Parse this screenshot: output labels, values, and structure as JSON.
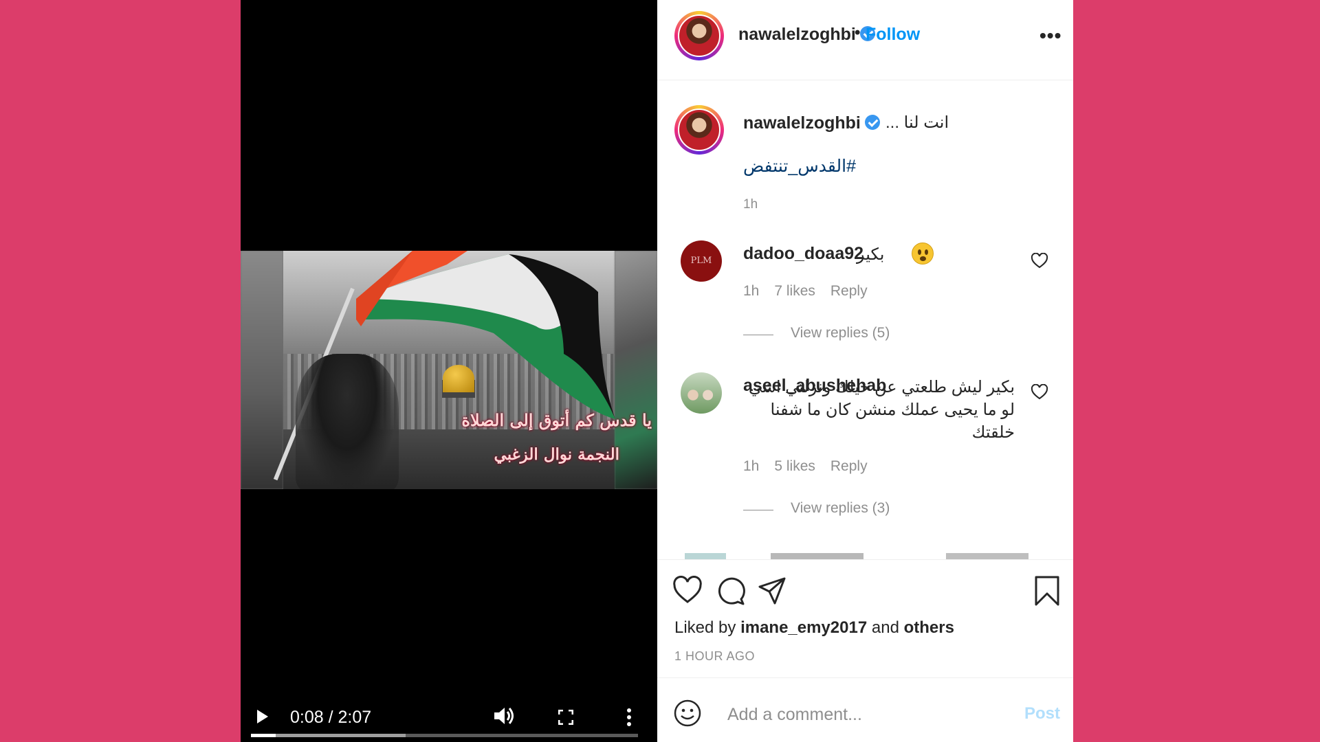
{
  "video": {
    "overlay_line1": "يا قدس كم أتوق إلى الصلاة",
    "overlay_line2": "النجمة نوال الزغبي",
    "time": "0:08 / 2:07",
    "progress_fraction": 0.064,
    "buffered_fraction": 0.4,
    "icons": [
      "play-icon",
      "volume-icon",
      "fullscreen-icon",
      "more-vertical-icon"
    ]
  },
  "header": {
    "username": "nawalelzoghbi",
    "separator": "•",
    "follow_label": "Follow",
    "more_label": "•••"
  },
  "caption": {
    "username": "nawalelzoghbi",
    "text": "انت لنا ...",
    "hashtag": "#القدس_تنتفض",
    "time": "1h"
  },
  "comments": [
    {
      "username": "dadoo_doaa92",
      "text": "بكير",
      "avatar_text": "PLM",
      "time": "1h",
      "likes": "7 likes",
      "reply_label": "Reply",
      "view_replies": "View replies (5)"
    },
    {
      "username": "aseel_abushehab",
      "text": "بكير ليش طلعتي عن حيلك ونزلتي اشي لو ما يحيى عملك منشن كان ما شفنا خلقتك",
      "time": "1h",
      "likes": "5 likes",
      "reply_label": "Reply",
      "view_replies": "View replies (3)"
    }
  ],
  "actions": {
    "liked_by_prefix": "Liked by",
    "liked_by_user": "imane_emy2017",
    "liked_by_and": "and",
    "liked_by_others": "others",
    "post_time": "1 HOUR AGO"
  },
  "add_comment": {
    "placeholder": "Add a comment...",
    "post_label": "Post"
  },
  "colors": {
    "background": "#DC3D6A",
    "accent_blue": "#0095F6",
    "post_disabled": "#B2DFFC",
    "verified": "#3897F0"
  }
}
